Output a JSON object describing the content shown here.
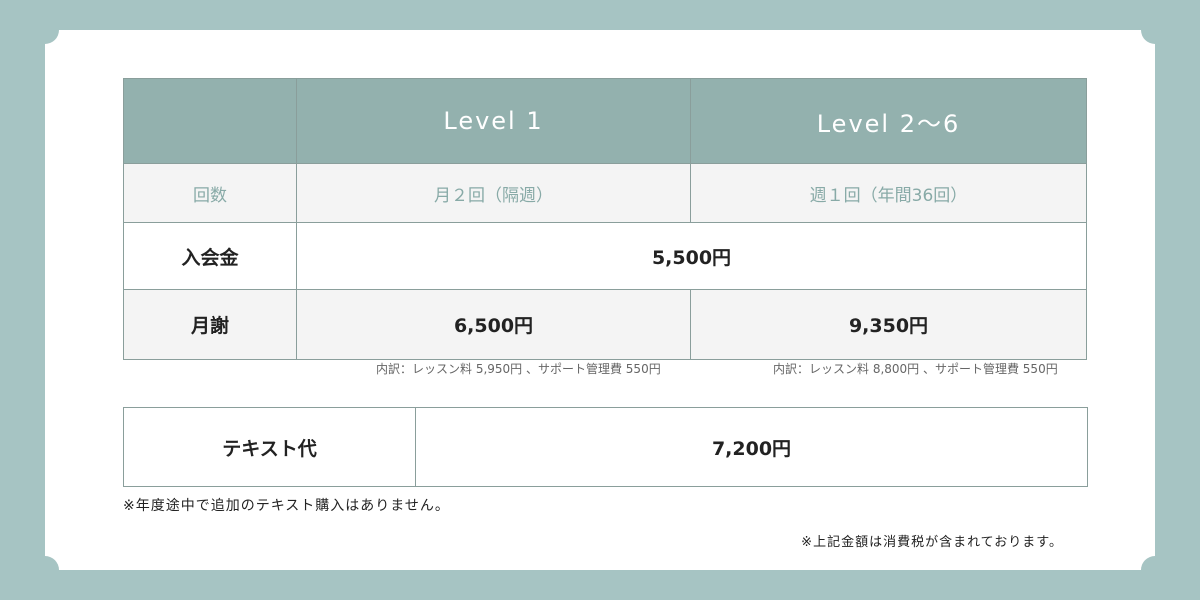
{
  "table": {
    "header": {
      "corner": "",
      "level1": "Level 1",
      "level2": "Level 2〜6"
    },
    "rows": {
      "frequency": {
        "label": "回数",
        "level1": "月２回（隔週）",
        "level2": "週１回（年間36回）"
      },
      "admission": {
        "label": "入会金",
        "value": "5,500円"
      },
      "monthly": {
        "label": "月謝",
        "level1": "6,500円",
        "level2": "9,350円"
      }
    },
    "breakdown": {
      "level1": "内訳：レッスン料 5,950円 、サポート管理費 550円",
      "level2": "内訳：レッスン料 8,800円 、サポート管理費 550円"
    }
  },
  "textbook": {
    "label": "テキスト代",
    "value": "7,200円"
  },
  "notes": {
    "textbook_note": "※年度途中で追加のテキスト購入はありません。",
    "tax_note": "※上記金額は消費税が含まれております。"
  },
  "colors": {
    "background": "#a6c4c3",
    "header": "#93b1ae",
    "accent_text": "#88aaa7",
    "row_tint": "#f4f4f4"
  }
}
